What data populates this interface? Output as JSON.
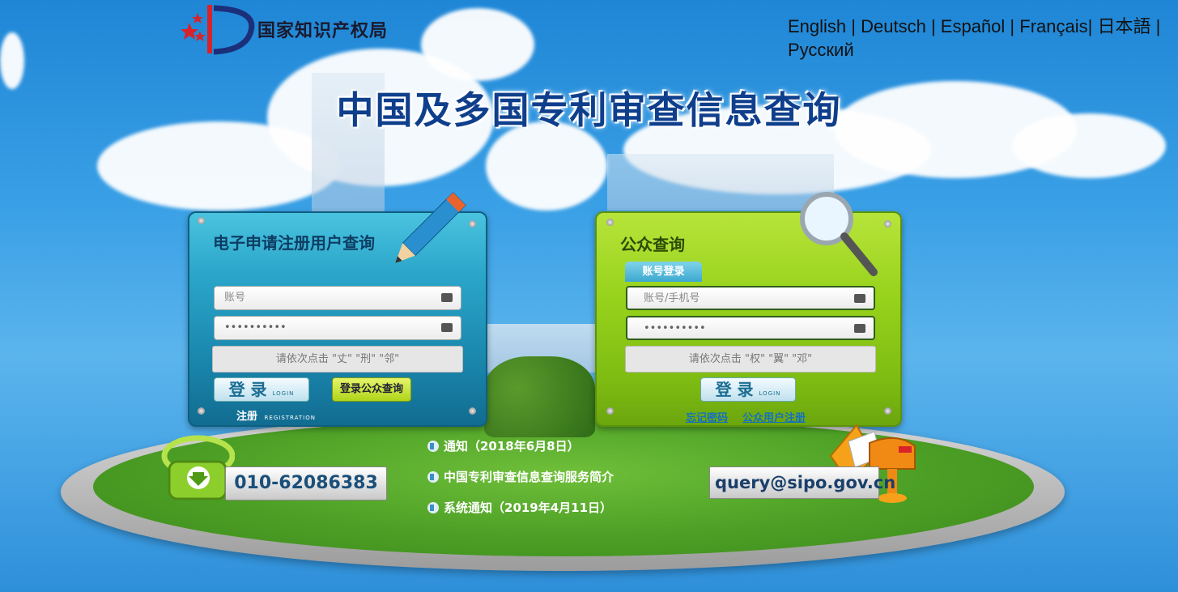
{
  "header": {
    "logo_text": "国家知识产权局",
    "languages": [
      "English",
      "Deutsch",
      "Español",
      "Français",
      "日本語",
      "Русский"
    ],
    "separators": [
      " | ",
      " | ",
      " | ",
      "| ",
      " | "
    ],
    "title": "中国及多国专利审查信息查询"
  },
  "panel_left": {
    "title": "电子申请注册用户查询",
    "account_placeholder": "账号",
    "password_value": "••••••••••",
    "captcha_text": "请依次点击 \"丈\" \"刑\" \"邻\"",
    "login_label": "登 录",
    "login_sub": "LOGIN",
    "public_button": "登录公众查询",
    "register_label": "注册",
    "register_sub": "REGISTRATION"
  },
  "panel_right": {
    "title": "公众查询",
    "tab_label": "账号登录",
    "account_placeholder": "账号/手机号",
    "password_value": "••••••••••",
    "captcha_text": "请依次点击 \"权\" \"翼\" \"邓\"",
    "login_label": "登 录",
    "login_sub": "LOGIN",
    "forgot_link": "忘记密码",
    "register_link": "公众用户注册"
  },
  "contact": {
    "phone": "010-62086383",
    "email": "query@sipo.gov.cn"
  },
  "notices": [
    "通知（2018年6月8日）",
    "中国专利审查信息查询服务简介",
    "系统通知（2019年4月11日）"
  ]
}
